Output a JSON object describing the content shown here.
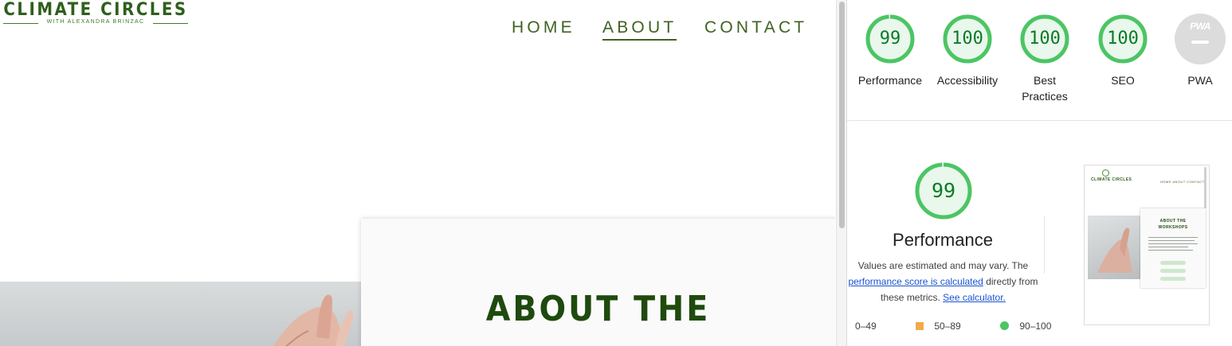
{
  "site": {
    "logo_title": "CLIMATE CIRCLES",
    "logo_subtitle": "WITH ALEXANDRA BRINZAC",
    "nav": [
      {
        "label": "HOME",
        "active": false
      },
      {
        "label": "ABOUT",
        "active": true
      },
      {
        "label": "CONTACT",
        "active": false
      }
    ],
    "card_title": "ABOUT THE"
  },
  "lighthouse": {
    "scores": [
      {
        "label": "Performance",
        "value": "99",
        "fraction": 0.99
      },
      {
        "label": "Accessibility",
        "value": "100",
        "fraction": 1.0
      },
      {
        "label": "Best Practices",
        "value": "100",
        "fraction": 1.0
      },
      {
        "label": "SEO",
        "value": "100",
        "fraction": 1.0
      }
    ],
    "pwa": {
      "label": "PWA",
      "badge_text": "PWA"
    },
    "detail": {
      "score": "99",
      "fraction": 0.99,
      "title": "Performance",
      "desc_prefix": "Values are estimated and may vary. The ",
      "desc_link": "performance score is calculated",
      "desc_middle": " directly from these metrics. ",
      "calc_link": "See calculator."
    },
    "legend": [
      {
        "range": "0–49",
        "shape": "triangle",
        "color": "#ff4e42"
      },
      {
        "range": "50–89",
        "shape": "square",
        "color": "#f0ab4a"
      },
      {
        "range": "90–100",
        "shape": "circle",
        "color": "#4cc564"
      }
    ],
    "colors": {
      "pass": "#0b7a26",
      "pass_ring": "#4cc564",
      "pass_fill": "#e9f7ec"
    }
  },
  "thumbnail": {
    "logo": "CLIMATE CIRCLES",
    "nav": "HOME  ABOUT  CONTACT",
    "card_title_1": "ABOUT THE",
    "card_title_2": "WORKSHOPS"
  }
}
